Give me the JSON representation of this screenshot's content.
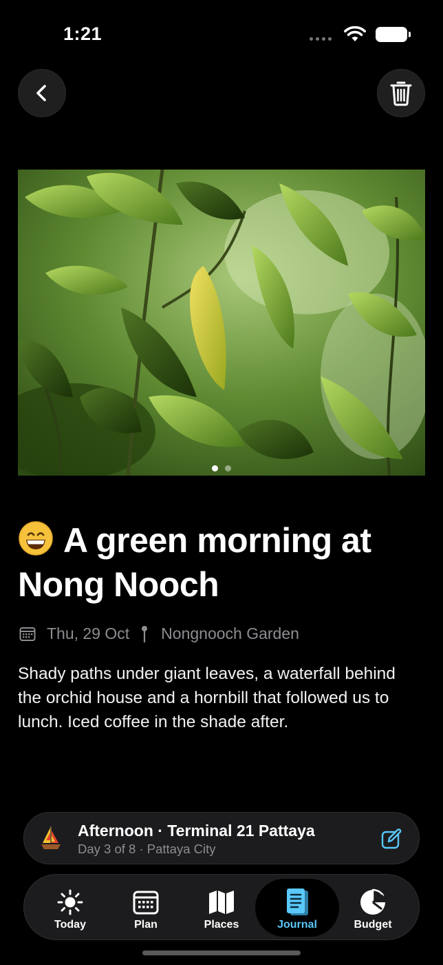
{
  "status_bar": {
    "time": "1:21"
  },
  "header": {
    "back_icon": "chevron-left-icon",
    "delete_icon": "trash-icon"
  },
  "photo": {
    "description_icon": "photo",
    "page_count": 2,
    "current_page": 1
  },
  "entry": {
    "emoji": "😄",
    "title": "A green morning at Nong Nooch",
    "date": "Thu, 29 Oct",
    "location": "Nongnooch Garden",
    "body": "Shady paths under giant leaves, a waterfall behind the orchid house and a hornbill that followed us to lunch. Iced coffee in the shade after."
  },
  "now_card": {
    "title": "Afternoon · Terminal 21 Pattaya",
    "subtitle": "Day 3 of 8 · Pattaya City",
    "icon": "sailboat-icon",
    "edit_icon": "edit-icon"
  },
  "tabs": [
    {
      "label": "Today",
      "icon": "sun-icon",
      "active": false
    },
    {
      "label": "Plan",
      "icon": "calendar-icon",
      "active": false
    },
    {
      "label": "Places",
      "icon": "map-icon",
      "active": false
    },
    {
      "label": "Journal",
      "icon": "journal-icon",
      "active": true
    },
    {
      "label": "Budget",
      "icon": "pie-chart-icon",
      "active": false
    }
  ],
  "colors": {
    "accent": "#5ac8fa",
    "background": "#000000",
    "card": "#1c1c1e",
    "muted_text": "#8d8d92"
  }
}
